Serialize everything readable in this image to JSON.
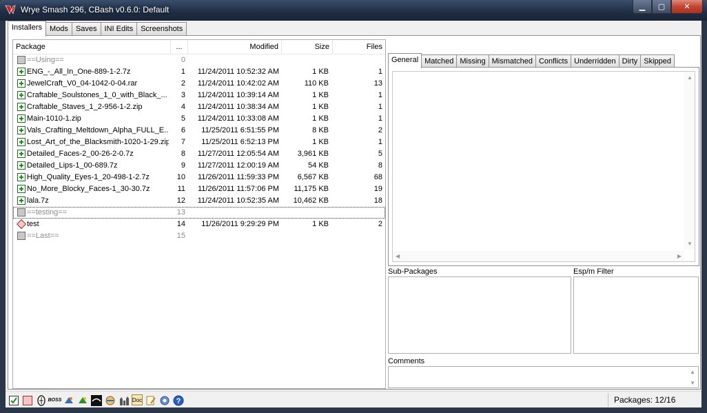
{
  "window": {
    "title": "Wrye Smash 296, CBash v0.6.0: Default"
  },
  "main_tabs": [
    "Installers",
    "Mods",
    "Saves",
    "INI Edits",
    "Screenshots"
  ],
  "columns": {
    "package": "Package",
    "order": "...",
    "modified": "Modified",
    "size": "Size",
    "files": "Files"
  },
  "rows": [
    {
      "icon": "gray",
      "name": "==Using==",
      "order": "0",
      "modified": "",
      "size": "",
      "files": "",
      "marker": true
    },
    {
      "icon": "plus",
      "name": "ENG_-_All_In_One-889-1-2.7z",
      "order": "1",
      "modified": "11/24/2011 10:52:32 AM",
      "size": "1 KB",
      "files": "1"
    },
    {
      "icon": "plus",
      "name": "JewelCraft_V0_04-1042-0-04.rar",
      "order": "2",
      "modified": "11/24/2011 10:42:02 AM",
      "size": "110 KB",
      "files": "13"
    },
    {
      "icon": "plus",
      "name": "Craftable_Soulstones_1_0_with_Black_...",
      "order": "3",
      "modified": "11/24/2011 10:39:14 AM",
      "size": "1 KB",
      "files": "1"
    },
    {
      "icon": "plus",
      "name": "Craftable_Staves_1_2-956-1-2.zip",
      "order": "4",
      "modified": "11/24/2011 10:38:34 AM",
      "size": "1 KB",
      "files": "1"
    },
    {
      "icon": "plus",
      "name": "Main-1010-1.zip",
      "order": "5",
      "modified": "11/24/2011 10:33:08 AM",
      "size": "1 KB",
      "files": "1"
    },
    {
      "icon": "plus",
      "name": "Vals_Crafting_Meltdown_Alpha_FULL_E...",
      "order": "6",
      "modified": "11/25/2011 6:51:55 PM",
      "size": "8 KB",
      "files": "2"
    },
    {
      "icon": "plus",
      "name": "Lost_Art_of_the_Blacksmith-1020-1-29.zip",
      "order": "7",
      "modified": "11/25/2011 6:52:13 PM",
      "size": "1 KB",
      "files": "1"
    },
    {
      "icon": "plus",
      "name": "Detailed_Faces-2_00-26-2-0.7z",
      "order": "8",
      "modified": "11/27/2011 12:05:54 AM",
      "size": "3,961 KB",
      "files": "5"
    },
    {
      "icon": "plus",
      "name": "Detailed_Lips-1_00-689.7z",
      "order": "9",
      "modified": "11/27/2011 12:00:19 AM",
      "size": "54 KB",
      "files": "8"
    },
    {
      "icon": "plus",
      "name": "High_Quality_Eyes-1_20-498-1-2.7z",
      "order": "10",
      "modified": "11/26/2011 11:59:33 PM",
      "size": "6,567 KB",
      "files": "68"
    },
    {
      "icon": "plus",
      "name": "No_More_Blocky_Faces-1_30-30.7z",
      "order": "11",
      "modified": "11/26/2011 11:57:06 PM",
      "size": "11,175 KB",
      "files": "19"
    },
    {
      "icon": "plus",
      "name": "lala.7z",
      "order": "12",
      "modified": "11/24/2011 10:52:35 AM",
      "size": "10,462 KB",
      "files": "18"
    },
    {
      "icon": "gray",
      "name": "==testing==",
      "order": "13",
      "modified": "",
      "size": "",
      "files": "",
      "marker": true,
      "selected": true
    },
    {
      "icon": "diamond",
      "name": "test",
      "order": "14",
      "modified": "11/26/2011 9:29:29 PM",
      "size": "1 KB",
      "files": "2"
    },
    {
      "icon": "gray",
      "name": "==Last==",
      "order": "15",
      "modified": "",
      "size": "",
      "files": "",
      "marker": true
    }
  ],
  "detail_tabs": [
    "General",
    "Matched",
    "Missing",
    "Mismatched",
    "Conflicts",
    "Underridden",
    "Dirty",
    "Skipped"
  ],
  "labels": {
    "sub_packages": "Sub-Packages",
    "espm_filter": "Esp/m Filter",
    "comments": "Comments"
  },
  "status": {
    "packages": "Packages: 12/16"
  },
  "toolbar_icons": [
    "checkbox-green-icon",
    "checkbox-red-icon",
    "oblivion-seal-icon",
    "boss-icon",
    "blender-icon",
    "blender-alt-icon",
    "tes-editor-icon",
    "globe-icon",
    "castle-icon",
    "doc-icon",
    "notepad-icon",
    "settings-icon",
    "help-icon"
  ],
  "toolbar_text": {
    "boss": "BOSS",
    "doc": "Doc"
  },
  "colors": {
    "plus": "#1e8e1e",
    "title_bg": "#1f2d44",
    "close": "#c24432"
  }
}
